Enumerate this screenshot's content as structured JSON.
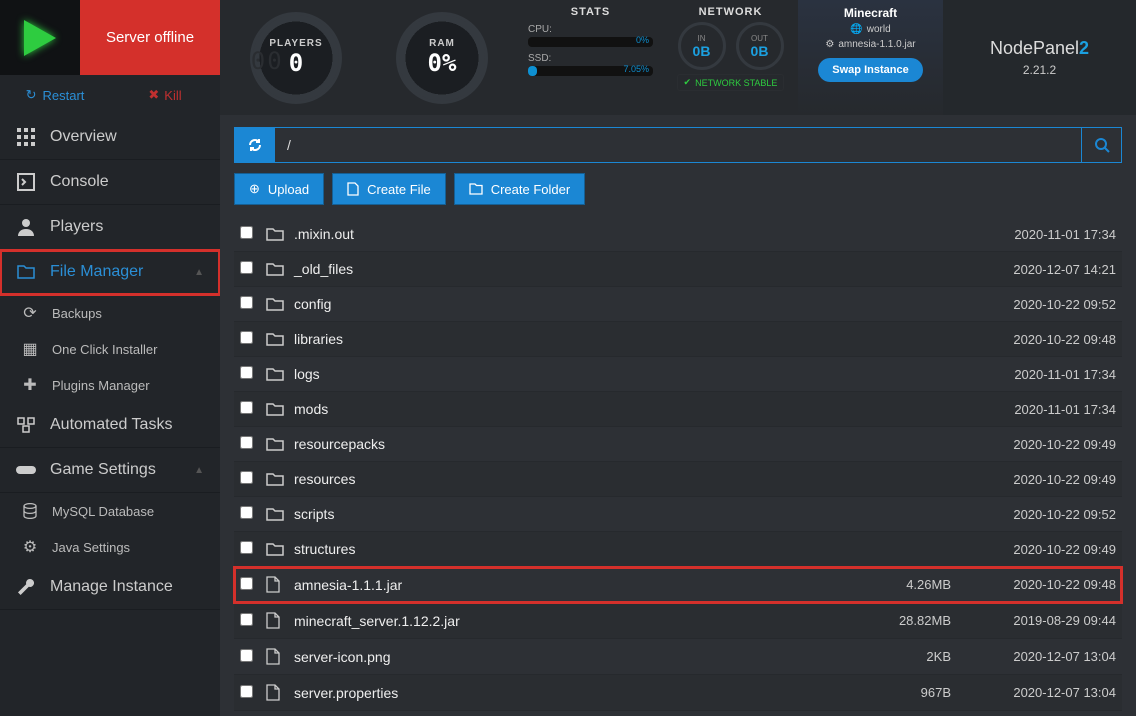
{
  "status": {
    "server": "Server offline",
    "restart": "Restart",
    "kill": "Kill"
  },
  "gauges": {
    "players": {
      "label": "PLAYERS",
      "value": "0"
    },
    "ram": {
      "label": "RAM",
      "value": "0%"
    }
  },
  "stats": {
    "title": "STATS",
    "cpu": {
      "label": "CPU:",
      "pct": "0%",
      "fill": 0
    },
    "ssd": {
      "label": "SSD:",
      "pct": "7.05%",
      "fill": 7.05
    }
  },
  "network": {
    "title": "NETWORK",
    "in": {
      "label": "IN",
      "value": "0B"
    },
    "out": {
      "label": "OUT",
      "value": "0B"
    },
    "status": "NETWORK STABLE"
  },
  "minecraft": {
    "title": "Minecraft",
    "world": "world",
    "jar": "amnesia-1.1.0.jar",
    "swap": "Swap Instance"
  },
  "brand": {
    "name": "NodePanel",
    "accent": "2",
    "version": "2.21.2"
  },
  "sidebar": {
    "overview": "Overview",
    "console": "Console",
    "players": "Players",
    "file_manager": "File Manager",
    "backups": "Backups",
    "one_click": "One Click Installer",
    "plugins": "Plugins Manager",
    "automated_tasks": "Automated Tasks",
    "game_settings": "Game Settings",
    "mysql": "MySQL Database",
    "java": "Java Settings",
    "manage_instance": "Manage Instance"
  },
  "path": {
    "value": "/"
  },
  "actions": {
    "upload": "Upload",
    "create_file": "Create File",
    "create_folder": "Create Folder"
  },
  "files": [
    {
      "type": "folder",
      "name": ".mixin.out",
      "size": "",
      "date": "2020-11-01 17:34"
    },
    {
      "type": "folder",
      "name": "_old_files",
      "size": "",
      "date": "2020-12-07 14:21"
    },
    {
      "type": "folder",
      "name": "config",
      "size": "",
      "date": "2020-10-22 09:52"
    },
    {
      "type": "folder",
      "name": "libraries",
      "size": "",
      "date": "2020-10-22 09:48"
    },
    {
      "type": "folder",
      "name": "logs",
      "size": "",
      "date": "2020-11-01 17:34"
    },
    {
      "type": "folder",
      "name": "mods",
      "size": "",
      "date": "2020-11-01 17:34"
    },
    {
      "type": "folder",
      "name": "resourcepacks",
      "size": "",
      "date": "2020-10-22 09:49"
    },
    {
      "type": "folder",
      "name": "resources",
      "size": "",
      "date": "2020-10-22 09:49"
    },
    {
      "type": "folder",
      "name": "scripts",
      "size": "",
      "date": "2020-10-22 09:52"
    },
    {
      "type": "folder",
      "name": "structures",
      "size": "",
      "date": "2020-10-22 09:49"
    },
    {
      "type": "file",
      "name": "amnesia-1.1.1.jar",
      "size": "4.26MB",
      "date": "2020-10-22 09:48",
      "highlighted": true
    },
    {
      "type": "file",
      "name": "minecraft_server.1.12.2.jar",
      "size": "28.82MB",
      "date": "2019-08-29 09:44"
    },
    {
      "type": "file",
      "name": "server-icon.png",
      "size": "2KB",
      "date": "2020-12-07 13:04"
    },
    {
      "type": "file",
      "name": "server.properties",
      "size": "967B",
      "date": "2020-12-07 13:04"
    }
  ]
}
